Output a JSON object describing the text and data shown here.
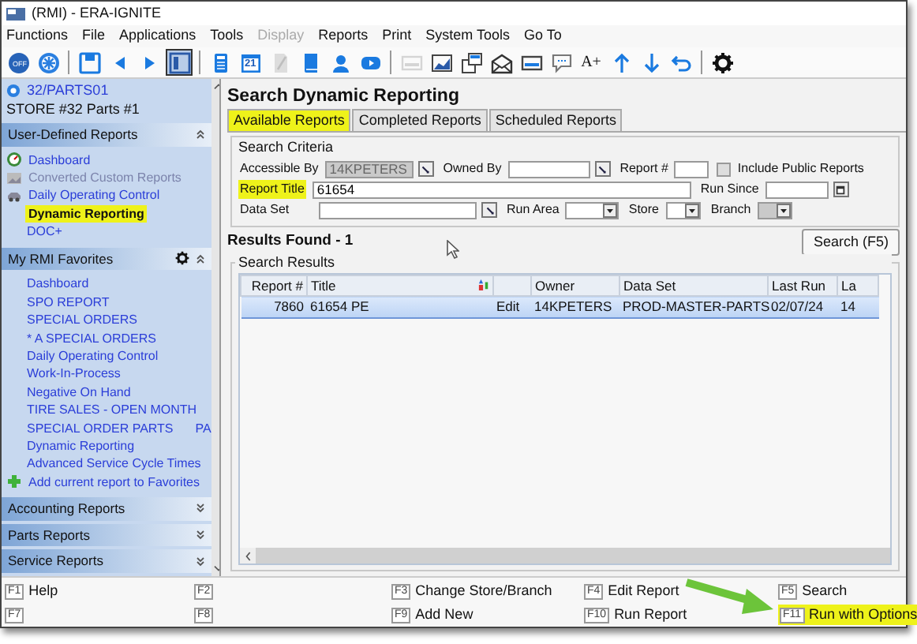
{
  "window": {
    "title": "(RMI) - ERA-IGNITE"
  },
  "menu": [
    {
      "label": "Functions",
      "disabled": false
    },
    {
      "label": "File",
      "disabled": false
    },
    {
      "label": "Applications",
      "disabled": false
    },
    {
      "label": "Tools",
      "disabled": false
    },
    {
      "label": "Display",
      "disabled": true
    },
    {
      "label": "Reports",
      "disabled": false
    },
    {
      "label": "Print",
      "disabled": false
    },
    {
      "label": "System Tools",
      "disabled": false
    },
    {
      "label": "Go To",
      "disabled": false
    }
  ],
  "toolbar": [
    [
      {
        "kind": "power",
        "label": "OFF",
        "selected": false,
        "disabled": false
      },
      {
        "kind": "burst",
        "selected": false,
        "disabled": false
      }
    ],
    [
      {
        "kind": "save",
        "selected": false,
        "disabled": false
      },
      {
        "kind": "left",
        "selected": false,
        "disabled": false
      },
      {
        "kind": "right",
        "selected": false,
        "disabled": false
      },
      {
        "kind": "panel",
        "selected": true,
        "disabled": false
      }
    ],
    [
      {
        "kind": "calculator",
        "selected": false,
        "disabled": false
      },
      {
        "kind": "calendar",
        "label": "21",
        "selected": false,
        "disabled": false
      },
      {
        "kind": "document",
        "selected": false,
        "disabled": true
      },
      {
        "kind": "book",
        "selected": false,
        "disabled": false
      },
      {
        "kind": "person",
        "selected": false,
        "disabled": false
      },
      {
        "kind": "video",
        "selected": false,
        "disabled": false
      }
    ],
    [
      {
        "kind": "card",
        "selected": false,
        "disabled": true
      },
      {
        "kind": "chart",
        "selected": false,
        "disabled": false
      },
      {
        "kind": "windows",
        "selected": false,
        "disabled": false
      },
      {
        "kind": "envelope",
        "selected": false,
        "disabled": false
      },
      {
        "kind": "card",
        "selected": false,
        "disabled": false
      },
      {
        "kind": "chat",
        "selected": false,
        "disabled": false
      },
      {
        "kind": "font",
        "label": "A+",
        "selected": false,
        "disabled": false
      },
      {
        "kind": "up",
        "selected": false,
        "disabled": false
      },
      {
        "kind": "down",
        "selected": false,
        "disabled": false
      },
      {
        "kind": "undo",
        "selected": false,
        "disabled": false
      }
    ],
    [
      {
        "kind": "gear",
        "selected": false,
        "disabled": false
      }
    ]
  ],
  "sidebar": {
    "store": {
      "code": "32/PARTS01",
      "name": "STORE #32 Parts #1"
    },
    "sections": [
      {
        "title": "User-Defined Reports",
        "expanded": true,
        "settings": false,
        "items": [
          {
            "label": "Dashboard",
            "kind": "gauge",
            "disabled": false,
            "highlighted": false
          },
          {
            "label": "Converted Custom Reports",
            "kind": "picture",
            "disabled": true,
            "highlighted": false
          },
          {
            "label": "Daily Operating Control",
            "kind": "vehicle",
            "disabled": false,
            "highlighted": false
          },
          {
            "label": "Dynamic Reporting",
            "kind": "plain",
            "disabled": false,
            "highlighted": true
          },
          {
            "label": "DOC+",
            "kind": "plain",
            "disabled": false,
            "highlighted": false
          }
        ]
      },
      {
        "title": "My RMI Favorites",
        "expanded": true,
        "settings": true,
        "items": [
          {
            "label": "Dashboard",
            "kind": "plain",
            "disabled": false,
            "highlighted": false
          },
          {
            "label": "SPO REPORT",
            "kind": "plain",
            "disabled": false,
            "highlighted": false
          },
          {
            "label": "SPECIAL ORDERS",
            "kind": "plain",
            "disabled": false,
            "highlighted": false
          },
          {
            "label": "* A SPECIAL ORDERS",
            "kind": "plain",
            "disabled": false,
            "highlighted": false
          },
          {
            "label": "Daily Operating Control",
            "kind": "plain",
            "disabled": false,
            "highlighted": false
          },
          {
            "label": "Work-In-Process",
            "kind": "plain",
            "disabled": false,
            "highlighted": false
          },
          {
            "label": "Negative On Hand",
            "kind": "plain",
            "disabled": false,
            "highlighted": false
          },
          {
            "label": "TIRE SALES - OPEN MONTH",
            "kind": "plain",
            "disabled": false,
            "highlighted": false
          },
          {
            "label": "SPECIAL ORDER PARTS",
            "overflow": "PA",
            "kind": "plain",
            "disabled": false,
            "highlighted": false
          },
          {
            "label": "Dynamic Reporting",
            "kind": "plain",
            "disabled": false,
            "highlighted": false
          },
          {
            "label": "Advanced Service Cycle Times",
            "kind": "plain",
            "disabled": false,
            "highlighted": false
          },
          {
            "label": "Add current report to Favorites",
            "kind": "add",
            "disabled": false,
            "highlighted": false
          }
        ]
      },
      {
        "title": "Accounting Reports",
        "expanded": false,
        "settings": false
      },
      {
        "title": "Parts Reports",
        "expanded": false,
        "settings": false
      },
      {
        "title": "Service Reports",
        "expanded": false,
        "settings": false
      }
    ]
  },
  "main": {
    "title": "Search Dynamic Reporting",
    "tabs": [
      {
        "label": "Available Reports",
        "selected": true
      },
      {
        "label": "Completed Reports",
        "selected": false
      },
      {
        "label": "Scheduled Reports",
        "selected": false
      }
    ],
    "criteria": {
      "title": "Search Criteria",
      "rows": [
        [
          {
            "label": "Accessible By",
            "kind": "lookup",
            "value": "14KPETERS",
            "disabled": true,
            "highlighted": false
          },
          {
            "label": "Owned By",
            "kind": "lookup",
            "disabled": false,
            "highlighted": false
          },
          {
            "label": "Report #",
            "kind": "text",
            "disabled": false,
            "highlighted": false
          },
          {
            "label": "Include Public Reports",
            "kind": "checkbox",
            "checked": false,
            "disabled": true,
            "highlighted": false
          }
        ],
        [
          {
            "label": "Report Title",
            "kind": "text",
            "value": "61654",
            "disabled": false,
            "highlighted": true
          },
          {
            "label": "Run Since",
            "kind": "date",
            "disabled": false,
            "highlighted": false
          }
        ],
        [
          {
            "label": "Data Set",
            "kind": "lookup",
            "disabled": false,
            "highlighted": false
          },
          {
            "label": "Run Area",
            "kind": "select",
            "disabled": false,
            "highlighted": false
          },
          {
            "label": "Store",
            "kind": "select",
            "disabled": false,
            "highlighted": false
          },
          {
            "label": "Branch",
            "kind": "select",
            "disabled": true,
            "highlighted": false
          }
        ]
      ]
    },
    "results_count": "Results Found - 1",
    "search_button": "Search (F5)",
    "results": {
      "title": "Search Results",
      "columns": [
        "Report #",
        "Title",
        "",
        "Owner",
        "Data Set",
        "Last Run",
        "La"
      ],
      "rows": [
        {
          "cells": [
            "7860",
            "61654 PE",
            "Edit",
            "14KPETERS",
            "PROD-MASTER-PARTS",
            "02/07/24",
            "14"
          ],
          "selected": true
        }
      ]
    }
  },
  "footer": [
    {
      "key": "F1",
      "label": "Help",
      "highlighted": false
    },
    {
      "key": "F2",
      "highlighted": false
    },
    {
      "key": "F3",
      "label": "Change Store/Branch",
      "highlighted": false
    },
    {
      "key": "F4",
      "label": "Edit Report",
      "highlighted": false
    },
    {
      "key": "F5",
      "label": "Search",
      "highlighted": false
    },
    {
      "key": "F7",
      "highlighted": false
    },
    {
      "key": "F8",
      "highlighted": false
    },
    {
      "key": "F9",
      "label": "Add New",
      "highlighted": false
    },
    {
      "key": "F10",
      "label": "Run Report",
      "highlighted": false
    },
    {
      "key": "F11",
      "label": "Run with Options",
      "highlighted": true
    }
  ]
}
